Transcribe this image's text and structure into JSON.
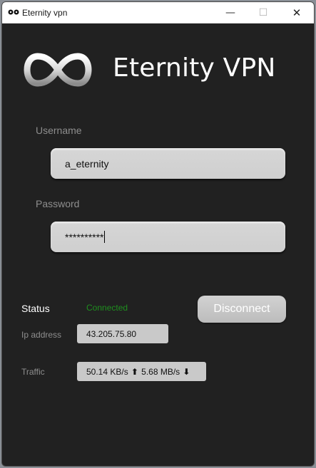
{
  "window": {
    "title": "Eternity vpn",
    "minimize_glyph": "—",
    "maximize_glyph": "☐",
    "close_glyph": "✕"
  },
  "app": {
    "title": "Eternity VPN"
  },
  "login": {
    "username_label": "Username",
    "username_value": "a_eternity",
    "password_label": "Password",
    "password_value": "**********"
  },
  "status": {
    "label": "Status",
    "value": "Connected",
    "value_color": "#1f8f1f",
    "disconnect_label": "Disconnect"
  },
  "info": {
    "ip_label": "Ip address",
    "ip_value": "43.205.75.80",
    "traffic_label": "Traffic",
    "upload": "50.14 KB/s",
    "upload_icon": "arrow-up-icon",
    "download": "5.68 MB/s",
    "download_icon": "arrow-down-icon"
  }
}
